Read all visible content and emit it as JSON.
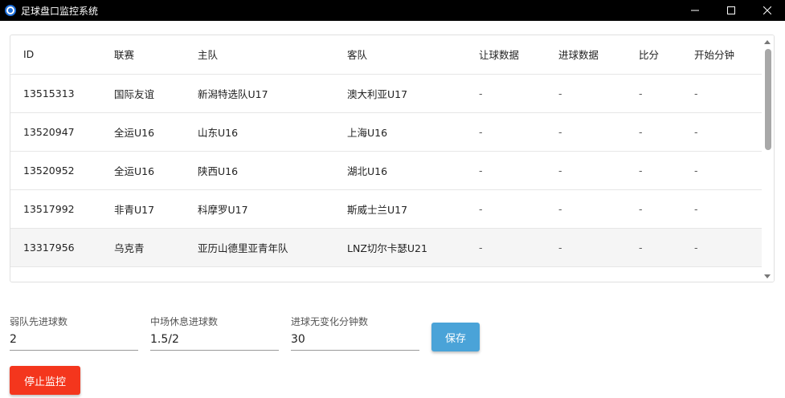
{
  "window": {
    "title": "足球盘口监控系统",
    "icon": "app-logo-icon",
    "controls": [
      "minimize-icon",
      "maximize-icon",
      "close-icon"
    ]
  },
  "table": {
    "headers": [
      "ID",
      "联赛",
      "主队",
      "客队",
      "让球数据",
      "进球数据",
      "比分",
      "开始分钟"
    ],
    "rows": [
      [
        "13515313",
        "国际友谊",
        "新潟特选队U17",
        "澳大利亚U17",
        "-",
        "-",
        "-",
        "-"
      ],
      [
        "13520947",
        "全运U16",
        "山东U16",
        "上海U16",
        "-",
        "-",
        "-",
        "-"
      ],
      [
        "13520952",
        "全运U16",
        "陕西U16",
        "湖北U16",
        "-",
        "-",
        "-",
        "-"
      ],
      [
        "13517992",
        "非青U17",
        "科摩罗U17",
        "斯威士兰U17",
        "-",
        "-",
        "-",
        "-"
      ],
      [
        "13317956",
        "乌克青",
        "亚历山德里亚青年队",
        "LNZ切尔卡瑟U21",
        "-",
        "-",
        "-",
        "-"
      ],
      [
        "",
        "",
        "",
        "",
        "",
        "",
        "",
        ""
      ]
    ],
    "highlighted_row": 4
  },
  "form": {
    "weak_first_goal": {
      "label": "弱队先进球数",
      "value": "2"
    },
    "halftime_goals": {
      "label": "中场休息进球数",
      "value": "1.5/2"
    },
    "no_change_minutes": {
      "label": "进球无变化分钟数",
      "value": "30"
    },
    "save_label": "保存",
    "stop_label": "停止监控"
  },
  "colors": {
    "save_button": "#4aa3d8",
    "stop_button": "#f4361d",
    "titlebar": "#000000"
  }
}
